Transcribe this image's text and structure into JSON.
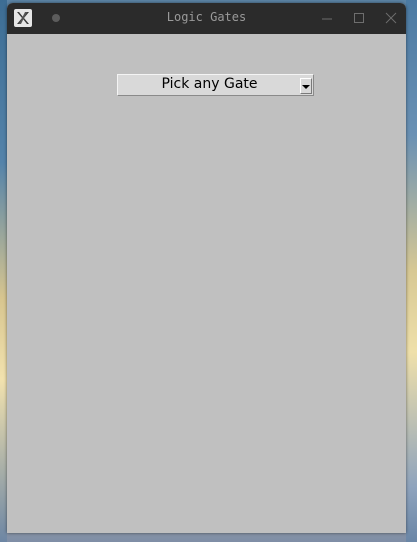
{
  "window": {
    "title": "Logic Gates",
    "icons": {
      "app": "x-app-icon",
      "pin": "pin-dot-icon",
      "minimize": "minimize-icon",
      "maximize": "maximize-icon",
      "close": "close-icon"
    }
  },
  "main": {
    "gate_menu": {
      "selected": "Pick any Gate",
      "indicator_icon": "dropdown-arrow-icon"
    }
  },
  "colors": {
    "titlebar": "#2b2b2b",
    "title_text": "#9a9a9a",
    "window_bg": "#c0c0c0",
    "menu_bg": "#d9d9d9"
  }
}
